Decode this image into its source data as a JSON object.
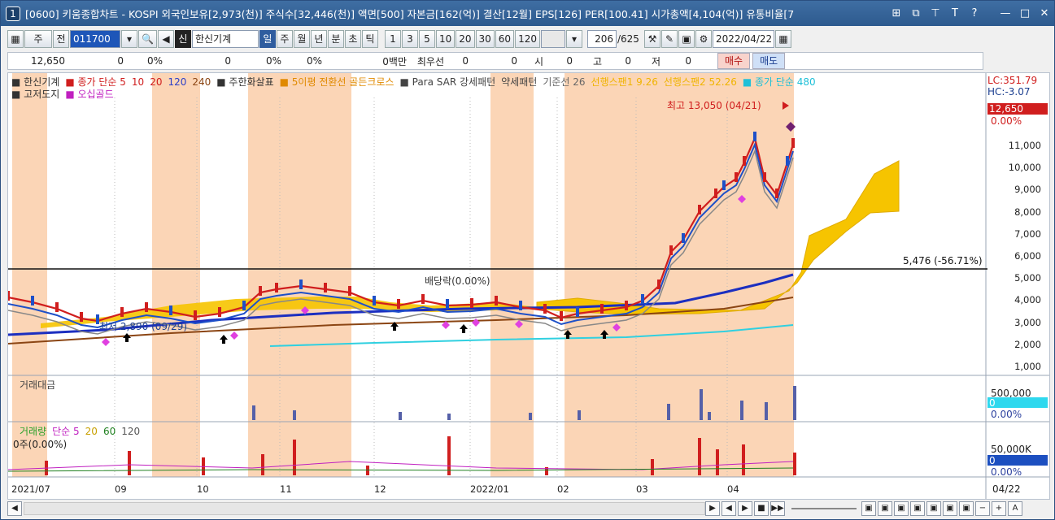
{
  "title": {
    "num": "1",
    "text": "[0600] 키움종합차트 - KOSPI 외국인보유[2,973(천)] 주식수[32,446(천)] 액면[500] 자본금[162(억)] 결산[12월] EPS[126] PER[100.41] 시가총액[4,104(억)] 유통비율[7",
    "icons": [
      "grid-icon",
      "restore-icon",
      "pin-icon",
      "font-icon",
      "help-icon",
      "minimize-icon",
      "maximize-icon",
      "close-icon"
    ],
    "icon_chars": [
      "⊞",
      "⧉",
      "⊤",
      "T",
      "?",
      "—",
      "□",
      "✕"
    ]
  },
  "toolbar": {
    "layout_btn": "▦",
    "period_select": "주",
    "prev_btn": "전",
    "code": "011700",
    "search_btn": "🔍",
    "sound_btn": "◀",
    "credit_badge": "신",
    "stock_name": "한신기계",
    "period_tabs": [
      "일",
      "주",
      "월",
      "년",
      "분",
      "초",
      "틱"
    ],
    "active_tab": "일",
    "interval_tabs": [
      "1",
      "3",
      "5",
      "10",
      "20",
      "30",
      "60",
      "120"
    ],
    "count": "206",
    "total": "/625",
    "date": "2022/04/22"
  },
  "info": {
    "price": "12,650",
    "v1": "0",
    "v2": "0%",
    "v3": "0",
    "v4": "0%",
    "v5": "0%",
    "v6": "0백만",
    "best_label": "최우선",
    "v7": "0",
    "v8": "0",
    "open_label": "시",
    "open": "0",
    "high_label": "고",
    "high": "0",
    "low_label": "저",
    "low": "0",
    "buy": "매수",
    "sell": "매도"
  },
  "legend": {
    "line1": [
      {
        "text": "■ 한신기계",
        "color": "#333"
      },
      {
        "text": "■ 종가 단순 5",
        "color": "#d01e1e"
      },
      {
        "text": "10",
        "color": "#d01e1e"
      },
      {
        "text": "20",
        "color": "#d01e1e"
      },
      {
        "text": "120",
        "color": "#2b3fc8"
      },
      {
        "text": "240",
        "color": "#8b4513"
      },
      {
        "text": "■ 주한화살표",
        "color": "#333"
      },
      {
        "text": "■ 5이평 전환선 골든크로스",
        "color": "#e08a00"
      },
      {
        "text": "■ Para SAR 강세패턴",
        "color": "#444"
      },
      {
        "text": "약세패턴",
        "color": "#444"
      },
      {
        "text": "기준선 26",
        "color": "#666"
      },
      {
        "text": "선행스팬1 9.26",
        "color": "#f0b400"
      },
      {
        "text": "선행스팬2 52.26",
        "color": "#f0b400"
      },
      {
        "text": "■ 종가 단순 480",
        "color": "#20c0d8"
      }
    ],
    "line2": [
      {
        "text": "■ 고저도지",
        "color": "#333"
      },
      {
        "text": "■ 오십골드",
        "color": "#c020c0"
      }
    ],
    "lc": "LC:351.79",
    "hc": "HC:-3.07"
  },
  "annotations": {
    "high_label": "최고 13,050 (04/21)",
    "dividend": "배당락(0.00%)",
    "low_label": "최저 2,890 (09/29)",
    "hline_label": "5,476 (-56.71%)"
  },
  "price_axis": {
    "current": "12,650",
    "current_pct": "0.00%",
    "ticks": [
      "11,000",
      "10,000",
      "9,000",
      "8,000",
      "7,000",
      "6,000",
      "5,000",
      "4,000",
      "3,000",
      "2,000",
      "1,000"
    ]
  },
  "panel2": {
    "title": "거래대금",
    "tick": "500,000",
    "current": "0",
    "pct": "0.00%"
  },
  "panel3": {
    "title": "거래량",
    "legend": [
      {
        "text": "거래량",
        "color": "#2aa02a"
      },
      {
        "text": "단순 5",
        "color": "#c020c0"
      },
      {
        "text": "20",
        "color": "#c8a000"
      },
      {
        "text": "60",
        "color": "#208020"
      },
      {
        "text": "120",
        "color": "#555"
      }
    ],
    "sub": "0주(0.00%)",
    "tick": "50,000K",
    "current": "0",
    "pct": "0.00%"
  },
  "time_axis": [
    "2021/07",
    "09",
    "10",
    "11",
    "12",
    "2022/01",
    "02",
    "03",
    "04"
  ],
  "time_axis_right": "04/22",
  "colors": {
    "highlight": "#fbd5b6",
    "up": "#d01e1e",
    "down": "#1e50c8",
    "cloud": "#f6c400",
    "ma120": "#1c2fc0",
    "ma240": "#8b4513",
    "ma480": "#30d0e0"
  }
}
